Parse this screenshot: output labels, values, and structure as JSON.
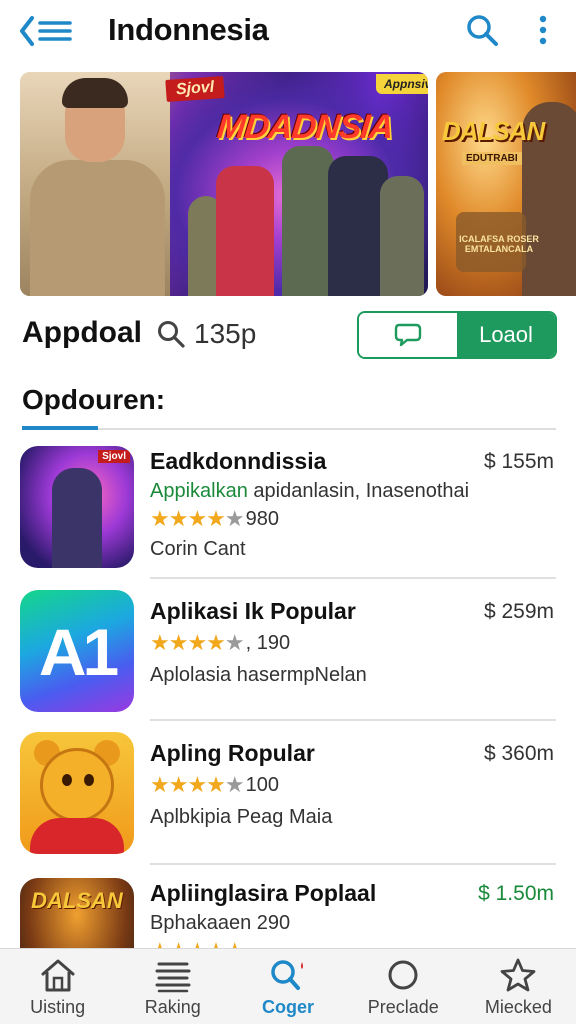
{
  "header": {
    "title": "Indonnesia"
  },
  "banners": [
    {
      "title": "MDADNSIA",
      "tag": "Sjovl",
      "badge": "Appnsiv"
    },
    {
      "title": "DALSAN",
      "subtitle": "EDUTRABI",
      "note": "ICALAFSA ROSER EMTALANCALA"
    }
  ],
  "info": {
    "app_label": "Appdoal",
    "search_count": "135p",
    "toggle_label": "Loaol"
  },
  "section": {
    "title": "Opdouren:"
  },
  "apps": [
    {
      "name": "Eadkdonndissia",
      "price": "$ 155m",
      "subtitle_green": "Appikalkan",
      "subtitle_rest": " apidanlasin, Inasenothai",
      "stars": 4,
      "rating_text": "980",
      "desc": "Corin Cant",
      "icon_tag": "Sjovl"
    },
    {
      "name": "Aplikasi Ik Popular",
      "price": "$ 259m",
      "stars": 4,
      "rating_text": ", 190",
      "desc": "Aplolasia hasermpNelan",
      "icon_text": "A1"
    },
    {
      "name": "Apling Ropular",
      "price": "$ 360m",
      "stars": 4,
      "rating_text": "100",
      "desc": "Aplbkipia Peag Maia"
    },
    {
      "name": "Apliinglasira Poplaal",
      "price": "$ 1.50m",
      "desc": "Bphakaaen 290",
      "icon_text": "DALSAN"
    }
  ],
  "nav": [
    {
      "label": "Uisting",
      "icon": "home-icon"
    },
    {
      "label": "Raking",
      "icon": "list-icon"
    },
    {
      "label": "Coger",
      "icon": "search-icon",
      "active": true
    },
    {
      "label": "Preclade",
      "icon": "circle-icon"
    },
    {
      "label": "Miecked",
      "icon": "star-icon"
    }
  ],
  "colors": {
    "accent": "#1e88c8",
    "green": "#1e9a5e",
    "star": "#f2a81d"
  }
}
